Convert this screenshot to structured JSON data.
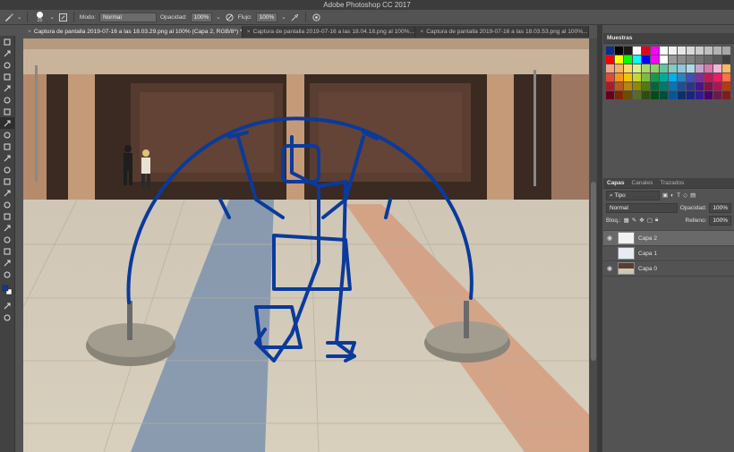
{
  "app_title": "Adobe Photoshop CC 2017",
  "options": {
    "brush_size": "25",
    "mode_label": "Modo:",
    "mode_value": "Normal",
    "opacity_label": "Opacidad:",
    "opacity_value": "100%",
    "flow_label": "Flujo:",
    "flow_value": "100%"
  },
  "tabs": [
    {
      "label": "Captura de pantalla 2019-07-16 a las 18.03.29.png al 100% (Capa 2, RGB/8*) *",
      "active": true
    },
    {
      "label": "Captura de pantalla 2019-07-16 a las 18.04.18.png al 100%...",
      "active": false
    },
    {
      "label": "Captura de pantalla 2019-07-16 a las 18.03.53.png al 100%...",
      "active": false
    }
  ],
  "swatches_panel": {
    "title": "Muestras",
    "colors": [
      "#0a2f8f",
      "#000000",
      "#1a1a1a",
      "#ffffff",
      "#e2001a",
      "#ff00ff",
      "#ffffff",
      "#f2f2f2",
      "#e6e6e6",
      "#d9d9d9",
      "#cccccc",
      "#bfbfbf",
      "#b3b3b3",
      "#a6a6a6",
      "#ff0000",
      "#ffff00",
      "#00ff00",
      "#00ffff",
      "#0000ff",
      "#ff00ff",
      "#ffffff",
      "#999999",
      "#8c8c8c",
      "#808080",
      "#737373",
      "#666666",
      "#595959",
      "#404040",
      "#f4a582",
      "#fdae61",
      "#ffd966",
      "#d9ef8b",
      "#a6d96a",
      "#91cf60",
      "#66c2a5",
      "#80cdc1",
      "#92c5de",
      "#abd9e9",
      "#c2a5cf",
      "#de77ae",
      "#f1b6da",
      "#fdb863",
      "#e34a33",
      "#f7941d",
      "#f2c500",
      "#c6d82b",
      "#7fbc41",
      "#1a9850",
      "#00a99d",
      "#00aeef",
      "#2b83ba",
      "#3f51b5",
      "#7b3294",
      "#c2185b",
      "#e91e63",
      "#ff7043",
      "#b2182b",
      "#c0561b",
      "#b8860b",
      "#8b8b00",
      "#4d7c0f",
      "#006837",
      "#00796b",
      "#0277bd",
      "#1f4e99",
      "#283593",
      "#4a148c",
      "#880e4f",
      "#ad1457",
      "#bf360c",
      "#67001f",
      "#7f2704",
      "#6b4e00",
      "#556b2f",
      "#2e4d12",
      "#004d1a",
      "#004d40",
      "#01579b",
      "#0d2f6e",
      "#1a237e",
      "#311b92",
      "#4a0072",
      "#6a1b4a",
      "#7f1d1d"
    ]
  },
  "layers_panel": {
    "tab_layers": "Capas",
    "tab_channels": "Canales",
    "tab_paths": "Trazados",
    "filter": "Tipo",
    "blend_mode": "Normal",
    "opacity_label": "Opacidad:",
    "opacity_value": "100%",
    "lock_label": "Bloq.:",
    "fill_label": "Relleno:",
    "fill_value": "100%",
    "layers": [
      {
        "name": "Capa 2",
        "visible": true,
        "selected": true
      },
      {
        "name": "Capa 1",
        "visible": false,
        "selected": false
      },
      {
        "name": "Capa 0",
        "visible": true,
        "selected": false
      }
    ]
  },
  "colors": {
    "drawing_blue": "#0a3a9b",
    "ui_dark": "#535353"
  }
}
